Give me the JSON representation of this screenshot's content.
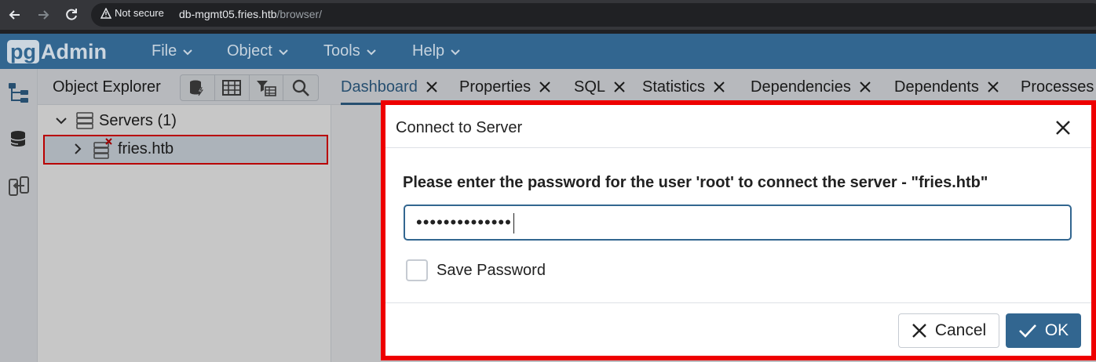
{
  "browser": {
    "security_label": "Not secure",
    "url_host": "db-mgmt05.fries.htb",
    "url_path": "/browser/"
  },
  "app": {
    "logo_pg": "pg",
    "logo_admin": "Admin",
    "menu": [
      {
        "label": "File"
      },
      {
        "label": "Object"
      },
      {
        "label": "Tools"
      },
      {
        "label": "Help"
      }
    ]
  },
  "explorer": {
    "title": "Object Explorer",
    "servers_label": "Servers (1)",
    "server_name": "fries.htb"
  },
  "tabs": [
    {
      "label": "Dashboard"
    },
    {
      "label": "Properties"
    },
    {
      "label": "SQL"
    },
    {
      "label": "Statistics"
    },
    {
      "label": "Dependencies"
    },
    {
      "label": "Dependents"
    },
    {
      "label": "Processes"
    }
  ],
  "dialog": {
    "title": "Connect to Server",
    "message": "Please enter the password for the user 'root' to connect the server - \"fries.htb\"",
    "password_value": "••••••••••••••",
    "save_password_label": "Save Password",
    "cancel_label": "Cancel",
    "ok_label": "OK"
  },
  "colors": {
    "brand": "#326690",
    "highlight_border": "#ee0000"
  }
}
